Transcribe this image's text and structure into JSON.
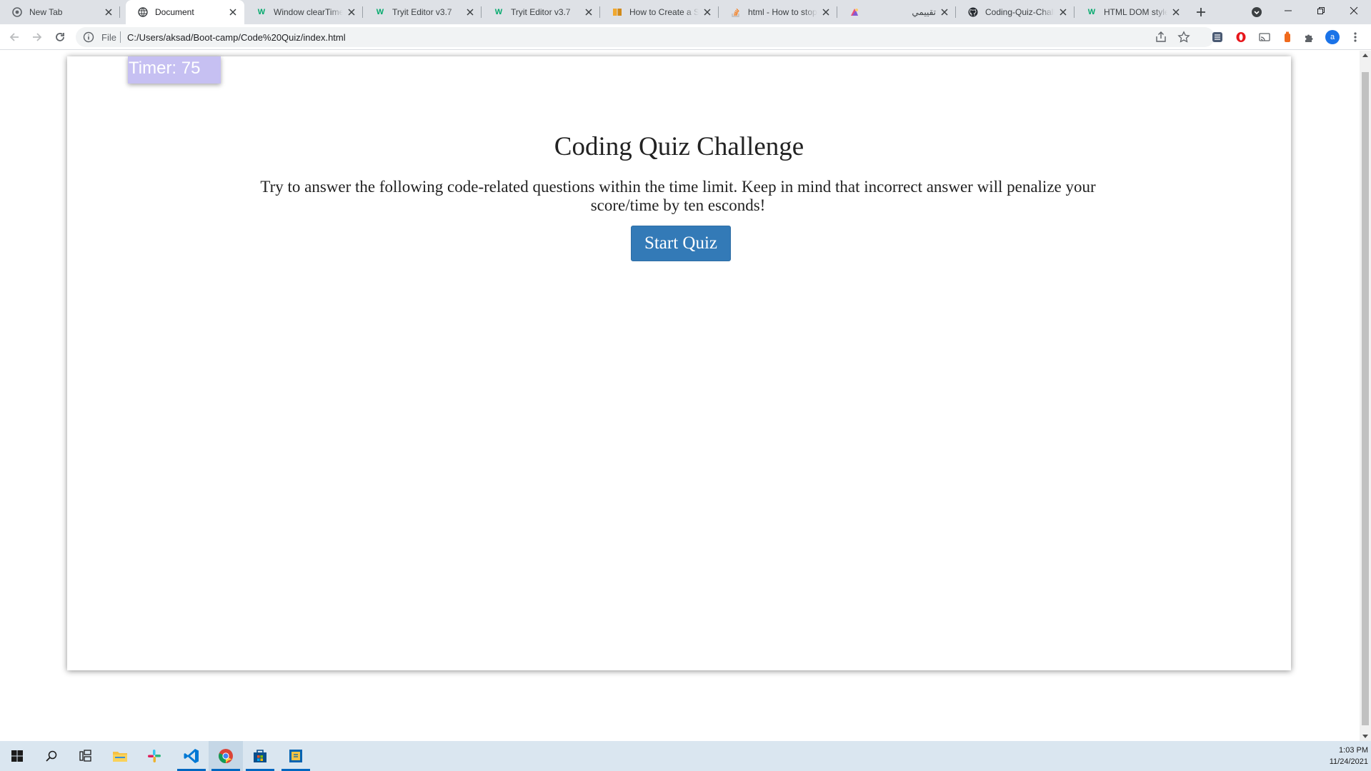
{
  "browser": {
    "tabs": [
      {
        "title": "New Tab",
        "icon": "chrome-icon",
        "active": false
      },
      {
        "title": "Document",
        "icon": "globe-icon",
        "active": true
      },
      {
        "title": "Window clearTimeout",
        "icon": "w3schools-icon",
        "active": false
      },
      {
        "title": "Tryit Editor v3.7",
        "icon": "w3schools-icon",
        "active": false
      },
      {
        "title": "Tryit Editor v3.7",
        "icon": "w3schools-icon",
        "active": false
      },
      {
        "title": "How to Create a Stopwatch",
        "icon": "book-icon",
        "active": false
      },
      {
        "title": "html - How to stop",
        "icon": "stackoverflow-icon",
        "active": false
      },
      {
        "title": "تقييمي",
        "icon": "colorful-app-icon",
        "active": false
      },
      {
        "title": "Coding-Quiz-Challenge",
        "icon": "github-icon",
        "active": false
      },
      {
        "title": "HTML DOM style Property",
        "icon": "w3schools-icon",
        "active": false
      }
    ],
    "address": {
      "scheme_label": "File",
      "url": "C:/Users/aksad/Boot-camp/Code%20Quiz/index.html"
    },
    "profile_initial": "a"
  },
  "page": {
    "timer_text": "Timer: 75",
    "title": "Coding Quiz Challenge",
    "description": "Try to answer the following code-related questions within the time limit. Keep in mind that incorrect answer will penalize your score/time by ten esconds!",
    "start_button": "Start Quiz"
  },
  "taskbar": {
    "time": "1:03 PM",
    "date": "11/24/2021",
    "apps": [
      "start-icon",
      "search-icon",
      "task-view-icon",
      "file-explorer-icon",
      "slack-icon",
      "vscode-icon",
      "chrome-icon",
      "store-icon",
      "sticky-app-icon"
    ]
  },
  "colors": {
    "accent_button": "#337ab7",
    "timer_bg": "#c6c0f2",
    "tabstrip_bg": "#dee1e6",
    "taskbar_bg": "#dae6f0"
  }
}
